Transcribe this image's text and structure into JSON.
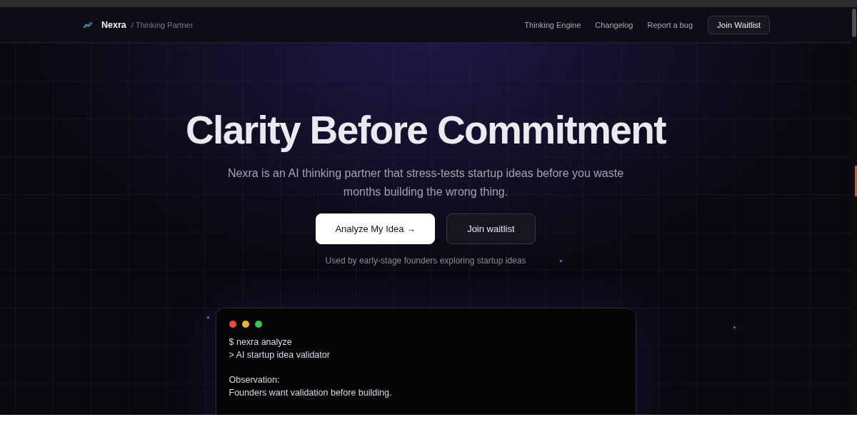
{
  "nav": {
    "brand": "Nexra",
    "tagline": "/ Thinking Partner",
    "links": [
      {
        "label": "Thinking Engine"
      },
      {
        "label": "Changelog"
      },
      {
        "label": "Report a bug"
      }
    ],
    "cta": "Join Waitlist"
  },
  "hero": {
    "title": "Clarity Before Commitment",
    "description": "Nexra is an AI thinking partner that stress-tests startup ideas before you waste months building the wrong thing.",
    "buttons": [
      {
        "label": "Analyze My Idea →",
        "kind": "primary"
      },
      {
        "label": "Join waitlist",
        "kind": "secondary"
      }
    ],
    "caption": "Used by early-stage founders exploring startup ideas"
  },
  "terminal": {
    "window_dots": [
      {
        "color": "#ef4a3f"
      },
      {
        "color": "#f0b32a"
      },
      {
        "color": "#41c24e"
      }
    ],
    "blocks": [
      [
        "$ nexra analyze",
        "> AI startup idea validator"
      ],
      [
        "Observation:",
        "Founders want validation before building."
      ]
    ]
  }
}
